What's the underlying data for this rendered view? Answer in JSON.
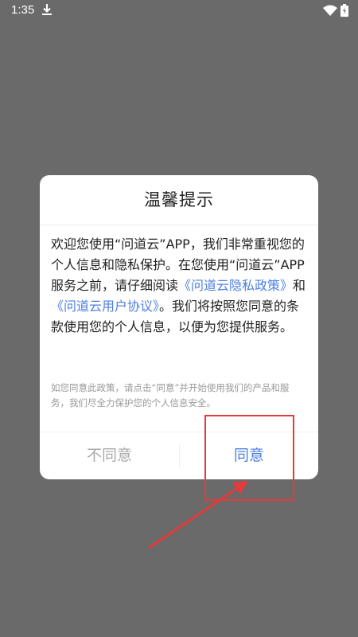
{
  "status_bar": {
    "time": "1:35",
    "icons": [
      "download-icon",
      "wifi-icon",
      "battery-icon"
    ]
  },
  "dialog": {
    "title": "温馨提示",
    "body": {
      "p1": "欢迎您使用“问道云”APP，我们非常重视您的个人信息和隐私保护。在您使用“问道云”APP服务之前，请仔细阅读",
      "link_privacy": "《问道云隐私政策》",
      "and_text": "和",
      "link_agreement": "《问道云用户协议》",
      "p2": "。我们将按照您同意的条款使用您的个人信息，以便为您提供服务。"
    },
    "note": "如您同意此政策，请点击“同意”并开始使用我们的产品和服务，我们尽全力保护您的个人信息安全。",
    "buttons": {
      "disagree": "不同意",
      "agree": "同意"
    }
  },
  "colors": {
    "overlay": "#6a6a6a",
    "link": "#4d7fe0",
    "annotation": "#e33b3b"
  }
}
